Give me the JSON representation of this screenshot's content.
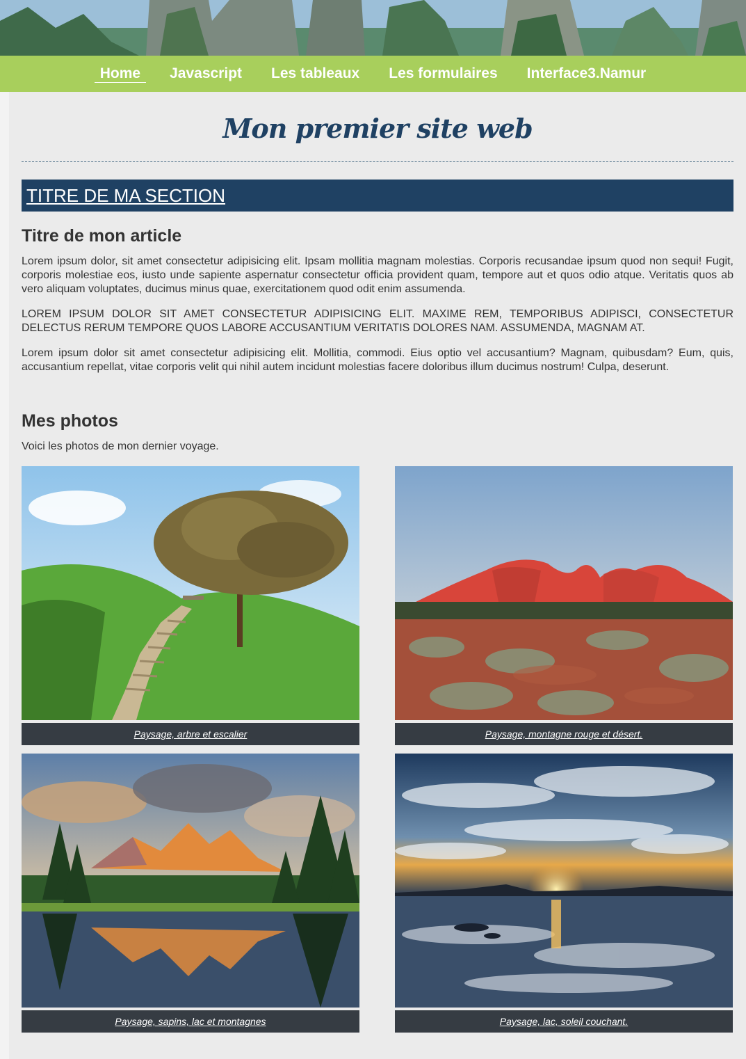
{
  "nav": {
    "items": [
      {
        "label": "Home",
        "active": true
      },
      {
        "label": "Javascript",
        "active": false
      },
      {
        "label": "Les tableaux",
        "active": false
      },
      {
        "label": "Les formulaires",
        "active": false
      },
      {
        "label": "Interface3.Namur",
        "active": false
      }
    ]
  },
  "header": {
    "title": "Mon premier site web"
  },
  "section": {
    "title": "TITRE DE MA SECTION"
  },
  "article": {
    "title": "Titre de mon article",
    "paragraphs": [
      "Lorem ipsum dolor, sit amet consectetur adipisicing elit. Ipsam mollitia magnam molestias. Corporis recusandae ipsum quod non sequi! Fugit, corporis molestiae eos, iusto unde sapiente aspernatur consectetur officia provident quam, tempore aut et quos odio atque. Veritatis quos ab vero aliquam voluptates, ducimus minus quae, exercitationem quod odit enim assumenda.",
      "Lorem ipsum dolor sit amet consectetur adipisicing elit. Maxime rem, temporibus adipisci, consectetur delectus rerum tempore quos labore accusantium veritatis dolores nam. Assumenda, magnam at.",
      "Lorem ipsum dolor sit amet consectetur adipisicing elit. Mollitia, commodi. Eius optio vel accusantium? Magnam, quibusdam? Eum, quis, accusantium repellat, vitae corporis velit qui nihil autem incidunt molestias facere doloribus illum ducimus nostrum! Culpa, deserunt."
    ]
  },
  "photos": {
    "title": "Mes photos",
    "intro": "Voici les photos de mon dernier voyage.",
    "items": [
      {
        "caption": "Paysage, arbre et escalier"
      },
      {
        "caption": "Paysage, montagne rouge et désert."
      },
      {
        "caption": "Paysage, sapins, lac et montagnes"
      },
      {
        "caption": "Paysage, lac, soleil couchant."
      }
    ]
  },
  "colors": {
    "nav_bg": "#a8cf5c",
    "title": "#1f4163",
    "section_bg": "#1f4163",
    "caption_bg": "#363c43",
    "content_bg": "#ebebeb"
  }
}
